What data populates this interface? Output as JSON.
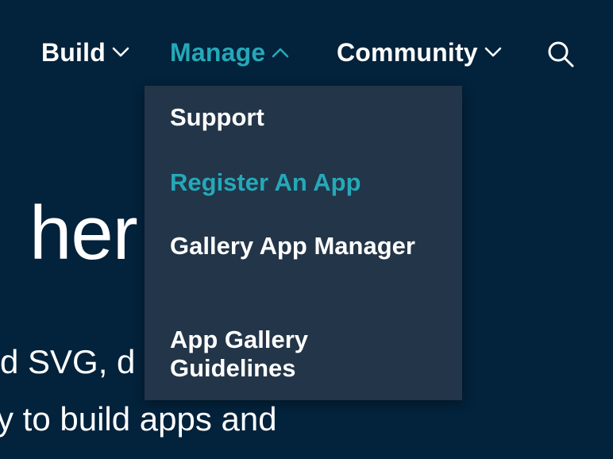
{
  "nav": {
    "items": [
      {
        "label": "Build",
        "icon": "chevron-down-icon"
      },
      {
        "label": "Manage",
        "icon": "chevron-up-icon"
      },
      {
        "label": "Community",
        "icon": "chevron-down-icon"
      }
    ],
    "search_icon": "search-icon",
    "active_color": "#24A9B9"
  },
  "dropdown": {
    "items": [
      {
        "label": "Support"
      },
      {
        "label": "Register An App"
      },
      {
        "label": "Gallery App Manager"
      },
      {
        "label": "App Gallery Guidelines"
      }
    ]
  },
  "hero": {
    "title": "her",
    "line1": "d SVG, d",
    "line2": "y to build apps and"
  },
  "colors": {
    "background": "#03223B",
    "dropdown_bg": "#233548",
    "accent": "#24A9B9",
    "text": "#FFFFFF"
  }
}
